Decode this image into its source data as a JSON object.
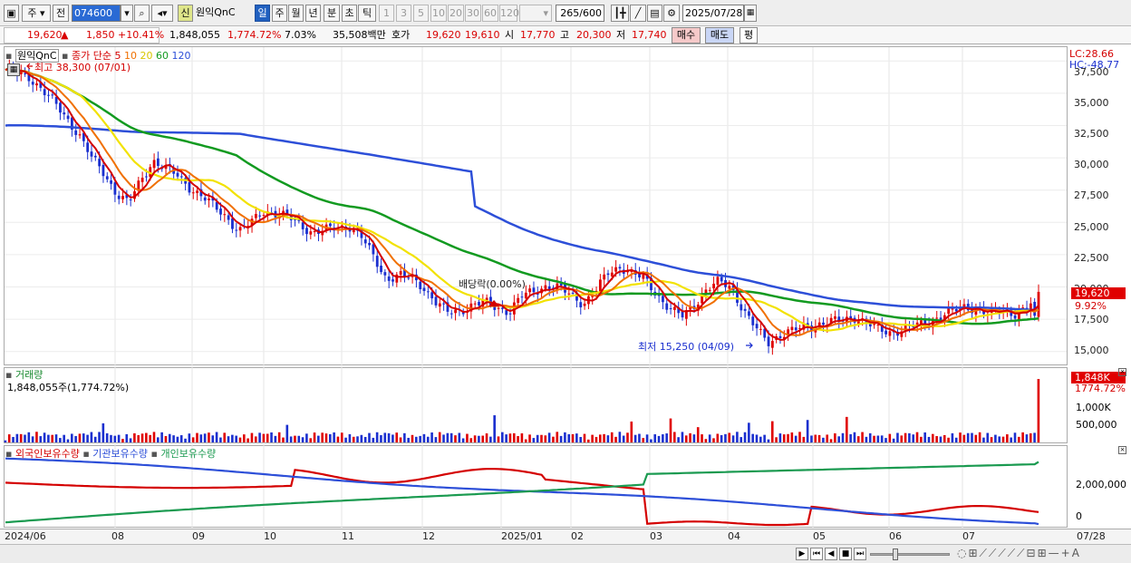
{
  "toolbar": {
    "type_label": "주",
    "view_label": "전",
    "code": "074600",
    "stock_name": "원익QnC",
    "periods": [
      "일",
      "주",
      "월",
      "년",
      "분",
      "초",
      "틱"
    ],
    "intervals": [
      "1",
      "3",
      "5",
      "10",
      "20",
      "30",
      "60",
      "120"
    ],
    "count": "265",
    "count_max": "/600",
    "date": "2025/07/28",
    "new_badge": "신"
  },
  "quote": {
    "price": "19,620",
    "arrow": "▲",
    "change": "1,850",
    "rate": "+10.41%",
    "volume": "1,848,055",
    "vol_rate": "1,774.72%",
    "turnover": "7.03%",
    "amount": "35,508백만",
    "hoga_label": "호가",
    "ask": "19,620",
    "bid": "19,610",
    "open_label": "시",
    "open": "17,770",
    "high_label": "고",
    "high": "20,300",
    "low_label": "저",
    "low": "17,740",
    "buy": "매수",
    "sell": "매도",
    "eval": "평"
  },
  "price_pane": {
    "name": "원익QnC",
    "legend_title": "종가 단순",
    "ma": [
      {
        "label": "5",
        "color": "#d40000"
      },
      {
        "label": "10",
        "color": "#f07000"
      },
      {
        "label": "20",
        "color": "#f2e200"
      },
      {
        "label": "60",
        "color": "#129a20"
      },
      {
        "label": "120",
        "color": "#2d4fd8"
      }
    ],
    "max_note": "최고 38,300 (07/01)",
    "min_note": "최저 15,250 (04/09)",
    "div_note": "배당락(0.00%)",
    "lc": "LC:28.66",
    "hc": "HC:-48.77",
    "last_tag": "19,620",
    "last_pct": "9.92%",
    "yticks": [
      "37,500",
      "35,000",
      "32,500",
      "30,000",
      "27,500",
      "25,000",
      "22,500",
      "20,000",
      "17,500",
      "15,000"
    ],
    "ylim": [
      14000,
      38500
    ]
  },
  "volume_pane": {
    "title": "거래량",
    "summary": "1,848,055주(1,774.72%)",
    "last_tag": "1,848K",
    "last_pct": "1774.72%",
    "yticks": [
      "1,000K",
      "500,000"
    ]
  },
  "holding_pane": {
    "series": [
      {
        "name": "외국인보유수량",
        "color": "#d40000"
      },
      {
        "name": "기관보유수량",
        "color": "#2d4fd8"
      },
      {
        "name": "개인보유수량",
        "color": "#1a9a50"
      }
    ],
    "yticks": [
      "2,000,000",
      "0"
    ]
  },
  "xaxis": [
    "2024/06",
    "08",
    "09",
    "10",
    "11",
    "12",
    "2025/01",
    "02",
    "03",
    "04",
    "05",
    "06",
    "07"
  ],
  "xaxis_end": "07/28",
  "chart_data": {
    "type": "line",
    "x_range": [
      "2024/06",
      "2025/07/28"
    ],
    "close": [
      36800,
      36500,
      36200,
      35300,
      34200,
      33000,
      31800,
      30000,
      28800,
      27300,
      26500,
      28200,
      29800,
      29200,
      28600,
      27700,
      27000,
      26200,
      25400,
      24300,
      25000,
      25900,
      25700,
      25400,
      24800,
      24200,
      24400,
      24600,
      24700,
      23800,
      22200,
      20600,
      20900,
      20700,
      20000,
      18800,
      18000,
      18200,
      18600,
      18800,
      18400,
      18100,
      19300,
      19700,
      20100,
      19900,
      19400,
      18700,
      19700,
      21100,
      21600,
      21000,
      20600,
      19400,
      18300,
      17700,
      18600,
      19800,
      20400,
      20000,
      18200,
      16800,
      15700,
      16300,
      16600,
      16900,
      17100,
      17300,
      17400,
      17700,
      17200,
      16700,
      16500,
      16700,
      17000,
      17300,
      17700,
      18100,
      18500,
      18300,
      17800,
      18300,
      17900,
      18200,
      19620
    ],
    "ma5_last": 18100,
    "ma20_last": 17900,
    "ma60_last": 17500,
    "ma120_last": 18200,
    "volume_last": 1848055,
    "holding_last": {
      "외국인보유수량": 500000,
      "기관보유수량": -200000,
      "개인보유수량": 3400000
    }
  },
  "colors": {
    "up": "#e00000",
    "down": "#1a2fcf",
    "ma5": "#d40000",
    "ma10": "#f07000",
    "ma20": "#f2e200",
    "ma60": "#129a20",
    "ma120": "#2d4fd8"
  }
}
